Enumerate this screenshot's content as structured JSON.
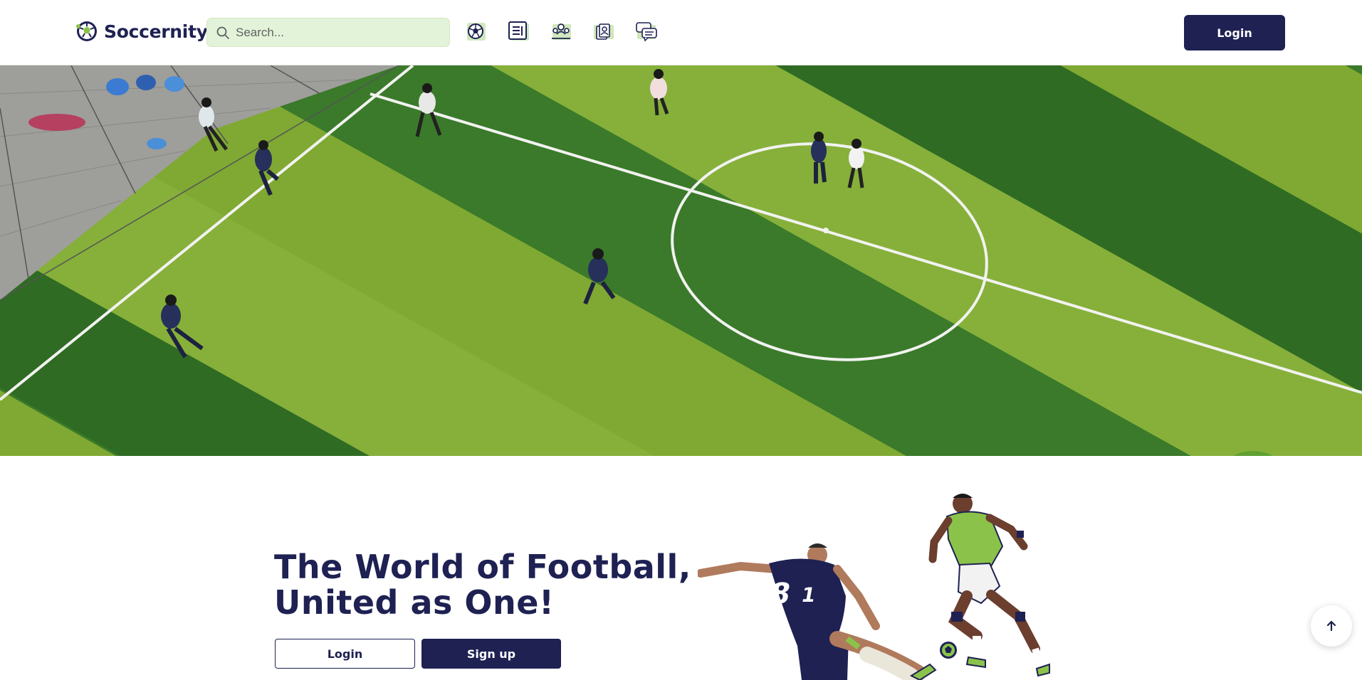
{
  "brand": {
    "name": "Soccernity",
    "logo_icon": "soccer-ball-logo-icon"
  },
  "search": {
    "placeholder": "Search...",
    "value": ""
  },
  "nav": [
    {
      "icon": "soccer-ball-icon",
      "name": "Matches"
    },
    {
      "icon": "news-icon",
      "name": "News"
    },
    {
      "icon": "community-icon",
      "name": "Community"
    },
    {
      "icon": "player-cards-icon",
      "name": "Players"
    },
    {
      "icon": "chat-icon",
      "name": "Chat"
    }
  ],
  "header": {
    "login_label": "Login"
  },
  "hero": {
    "image": "aerial-football-pitch"
  },
  "main": {
    "headline_line1": "The World of Football,",
    "headline_line2": "United as One!",
    "login_label": "Login",
    "signup_label": "Sign up"
  },
  "colors": {
    "primary": "#1e2152",
    "accent_green": "#8bc34a",
    "search_bg": "#e3f3d9",
    "pitch_dark": "#2f6b23",
    "pitch_light": "#7fa932"
  }
}
